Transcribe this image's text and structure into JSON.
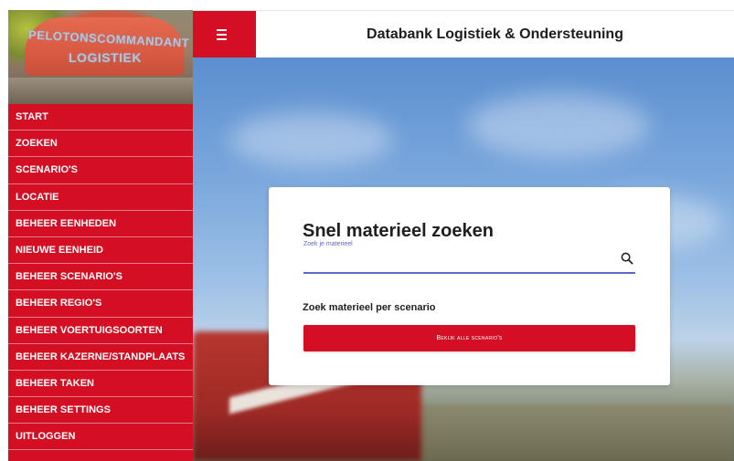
{
  "logo": {
    "line1": "PELOTONSCOMMANDANT",
    "line2": "LOGISTIEK"
  },
  "sidebar": {
    "items": [
      {
        "label": "START"
      },
      {
        "label": "ZOEKEN"
      },
      {
        "label": "SCENARIO'S"
      },
      {
        "label": "LOCATIE"
      },
      {
        "label": "BEHEER EENHEDEN"
      },
      {
        "label": "NIEUWE EENHEID"
      },
      {
        "label": "BEHEER SCENARIO'S"
      },
      {
        "label": "BEHEER REGIO'S"
      },
      {
        "label": "BEHEER VOERTUIGSOORTEN"
      },
      {
        "label": "BEHEER KAZERNE/STANDPLAATS"
      },
      {
        "label": "BEHEER TAKEN"
      },
      {
        "label": "BEHEER SETTINGS"
      },
      {
        "label": "UITLOGGEN"
      }
    ]
  },
  "header": {
    "menu_icon": "hamburger-icon",
    "title": "Databank Logistiek & Ondersteuning"
  },
  "card": {
    "title": "Snel materieel zoeken",
    "search": {
      "label": "Zoek je materieel",
      "value": "",
      "placeholder": "",
      "icon": "search-icon"
    },
    "scenario_heading": "Zoek materieel per scenario",
    "scenario_button_label": "Bekijk alle scenario's"
  },
  "colors": {
    "brand_red": "#d40f23",
    "accent_blue": "#5969c8",
    "text_dark": "#1f1f1f"
  }
}
